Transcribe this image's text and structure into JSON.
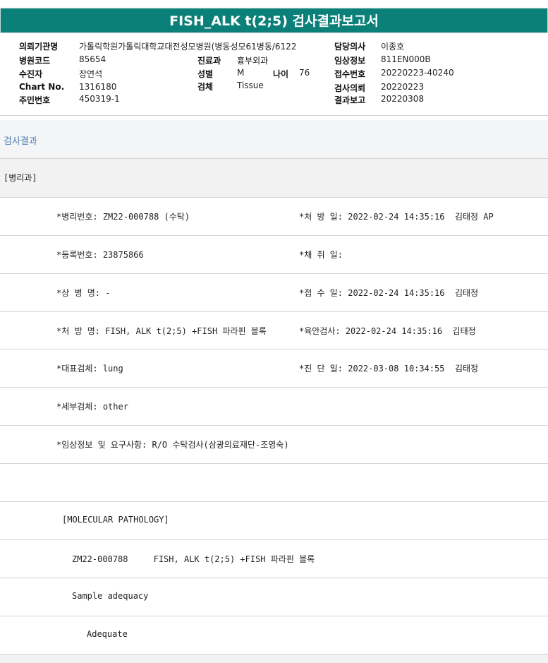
{
  "title": "FISH_ALK t(2;5) 검사결과보고서",
  "header": {
    "institution_label": "의뢰기관명",
    "institution_value": "가톨릭학원가톨릭대학교대전성모병원(병동성모61병동/6122",
    "hospital_code_label": "병원코드",
    "hospital_code_value": "85654",
    "patient_label": "수진자",
    "patient_value": "장연석",
    "chart_label": "Chart No.",
    "chart_value": "1316180",
    "resident_label": "주민번호",
    "resident_value": "450319-1",
    "dept_label": "진료과",
    "dept_value": "흉부외과",
    "sex_label": "성별",
    "sex_value": "M",
    "age_label": "나이",
    "age_value": "76",
    "specimen_label": "검체",
    "specimen_value": "Tissue",
    "doctor_label": "담당의사",
    "doctor_value": "이종호",
    "clinical_label": "임상정보",
    "clinical_value": "811EN000B",
    "receipt_label": "접수번호",
    "receipt_value": "20220223-40240",
    "request_label": "검사의뢰",
    "request_value": "20220223",
    "report_label": "결과보고",
    "report_value": "20220308"
  },
  "section_title": "검사결과",
  "results": {
    "dept_line": "[병리과]",
    "r1_left": "*병리번호: ZM22-000788 (수탁)",
    "r1_right": "*처 방 일: 2022-02-24 14:35:16  김태정 AP",
    "r2_left": "*등록번호: 23875866",
    "r2_right": "*채 취 일:",
    "r3_left": "*상 병 명: -",
    "r3_right": "*접 수 일: 2022-02-24 14:35:16  김태정",
    "r4_left": "*처 방 명: FISH, ALK t(2;5) +FISH 파라핀 블록",
    "r4_right": "*육안검사: 2022-02-24 14:35:16  김태정",
    "r5_left": "*대표검체: lung",
    "r5_right": "*진 단 일: 2022-03-08 10:34:55  김태정",
    "r6_left": "*세부검체: other",
    "r7_left": "*임상정보 및 요구사항: R/O 수탁검사(삼광의료재단-조영숙)",
    "mol_title": "[MOLECULAR PATHOLOGY]",
    "mol_line": "ZM22-000788     FISH, ALK t(2;5) +FISH 파라핀 블록",
    "adequacy_label": "Sample adequacy",
    "adequacy_value": "Adequate"
  }
}
